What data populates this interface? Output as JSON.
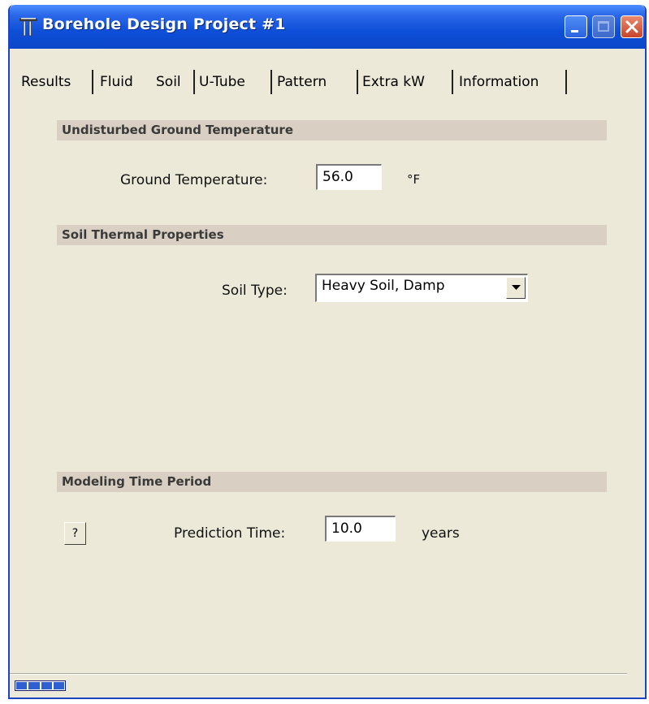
{
  "window": {
    "title": "Borehole Design Project #1",
    "icons": {
      "app": "borehole-app-icon",
      "minimize": "minimize-icon",
      "maximize": "maximize-icon",
      "close": "close-icon"
    },
    "colors": {
      "titlebar": "#0e4fd8",
      "body": "#ece9d8",
      "section_header": "#d9cfc3",
      "close": "#c8442a"
    }
  },
  "tabs": [
    {
      "label": "Results",
      "active": false
    },
    {
      "label": "Fluid",
      "active": false
    },
    {
      "label": "Soil",
      "active": true
    },
    {
      "label": "U-Tube",
      "active": false
    },
    {
      "label": "Pattern",
      "active": false
    },
    {
      "label": "Extra kW",
      "active": false
    },
    {
      "label": "Information",
      "active": false
    }
  ],
  "ground": {
    "header": "Undisturbed Ground Temperature",
    "label": "Ground Temperature:",
    "value": "56.0",
    "unit": "°F"
  },
  "soil": {
    "header": "Soil Thermal Properties",
    "label": "Soil Type:",
    "selected": "Heavy Soil, Damp",
    "dropdown_icon": "chevron-down-icon"
  },
  "modeling": {
    "header": "Modeling Time Period",
    "help_label": "?",
    "label": "Prediction Time:",
    "value": "10.0",
    "unit": "years"
  },
  "status": {
    "progress_segments": 4
  }
}
